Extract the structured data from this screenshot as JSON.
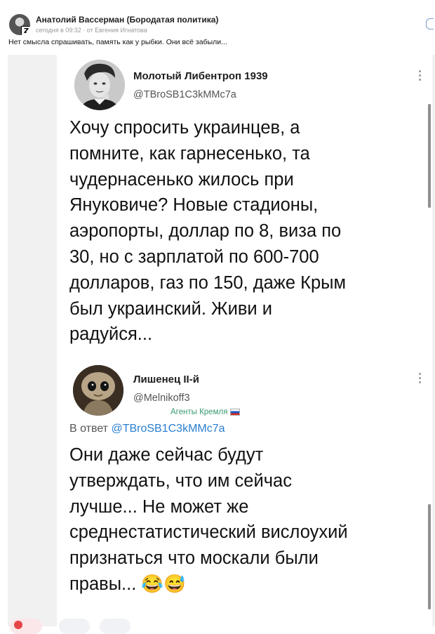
{
  "post": {
    "author": "Анатолий Вассерман (Бородатая политика)",
    "meta": "сегодня в 09:32 · от Евгения Игнатова",
    "caption": "Нет смысла спрашивать, память как у рыбки. Они всё забыли...",
    "avatar_badge": "Z"
  },
  "tweet1": {
    "name": "Молотый Либентроп 1939",
    "handle": "@TBroSB1C3kMMc7a",
    "lines": [
      "Хочу спросить украинцев, а",
      "помните, как гарнесенько, та",
      "чудернасенько жилось при",
      "Януковиче? Новые стадионы,",
      "аэропорты, доллар по 8, виза по",
      "30, но с зарплатой по 600-700",
      "долларов, газ по 150, даже Крым",
      "был украинский. Живи и",
      "радуйся..."
    ]
  },
  "tweet2": {
    "name": "Лишенец II-й",
    "handle": "@Melnikoff3",
    "label": "Агенты Кремля",
    "reply_prefix": "В ответ",
    "reply_handle": "@TBroSB1C3kMMc7a",
    "lines": [
      "Они даже сейчас будут",
      "утверждать, что им сейчас",
      "лучше... Не может же",
      "среднестатистический вислоухий",
      "признаться что москали были",
      "правы..."
    ],
    "emoji": "😂😅"
  },
  "icons": {
    "kebab": "more-options-icon",
    "flag": "russian-flag-icon",
    "like": "heart-icon"
  }
}
